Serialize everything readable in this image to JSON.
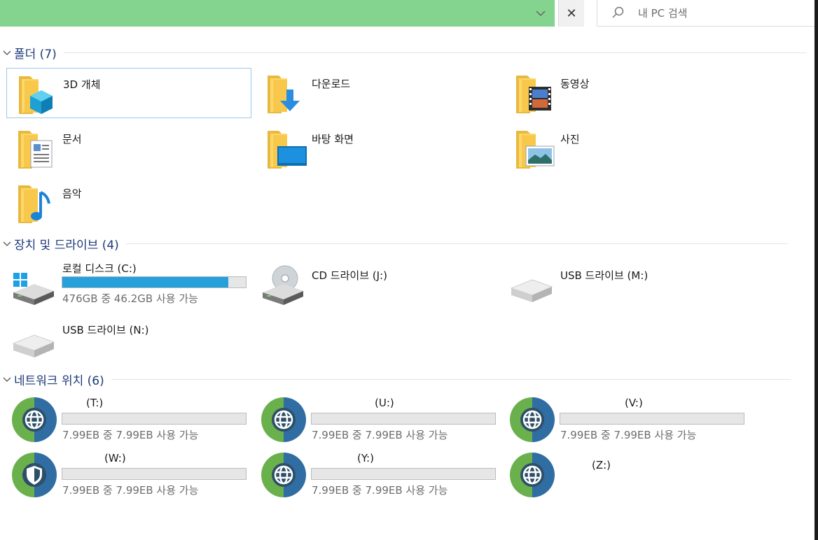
{
  "toolbar": {
    "search_placeholder": "내 PC 검색",
    "close_glyph": "✕"
  },
  "sections": {
    "folders": {
      "title": "폴더 (7)"
    },
    "devices": {
      "title": "장치 및 드라이브 (4)"
    },
    "network": {
      "title": "네트워크 위치 (6)"
    }
  },
  "folders": [
    {
      "label": "3D 개체",
      "icon": "3d-objects-icon"
    },
    {
      "label": "다운로드",
      "icon": "downloads-icon"
    },
    {
      "label": "동영상",
      "icon": "videos-icon"
    },
    {
      "label": "문서",
      "icon": "documents-icon"
    },
    {
      "label": "바탕 화면",
      "icon": "desktop-icon"
    },
    {
      "label": "사진",
      "icon": "pictures-icon"
    },
    {
      "label": "음악",
      "icon": "music-icon"
    }
  ],
  "drives": [
    {
      "name": "로컬 디스크 (C:)",
      "free_text": "476GB 중 46.2GB 사용 가능",
      "used_fraction": 0.903
    },
    {
      "name": "CD 드라이브 (J:)"
    },
    {
      "name": "USB 드라이브 (M:)"
    },
    {
      "name": "USB 드라이브 (N:)"
    }
  ],
  "network": [
    {
      "name": "(T:)",
      "free_text": "7.99EB 중 7.99EB 사용 가능",
      "used_fraction": 0
    },
    {
      "name": "(U:)",
      "free_text": "7.99EB 중 7.99EB 사용 가능",
      "used_fraction": 0
    },
    {
      "name": "(V:)",
      "free_text": "7.99EB 중 7.99EB 사용 가능",
      "used_fraction": 0
    },
    {
      "name": "(W:)",
      "free_text": "7.99EB 중 7.99EB 사용 가능",
      "used_fraction": 0
    },
    {
      "name": "(Y:)",
      "free_text": "7.99EB 중 7.99EB 사용 가능",
      "used_fraction": 0
    },
    {
      "name": "(Z:)"
    }
  ],
  "colors": {
    "address_bar": "#84d48f",
    "section_title": "#1e3a78",
    "usage_bar": "#26a0da",
    "selection_border": "#99c9ea"
  }
}
